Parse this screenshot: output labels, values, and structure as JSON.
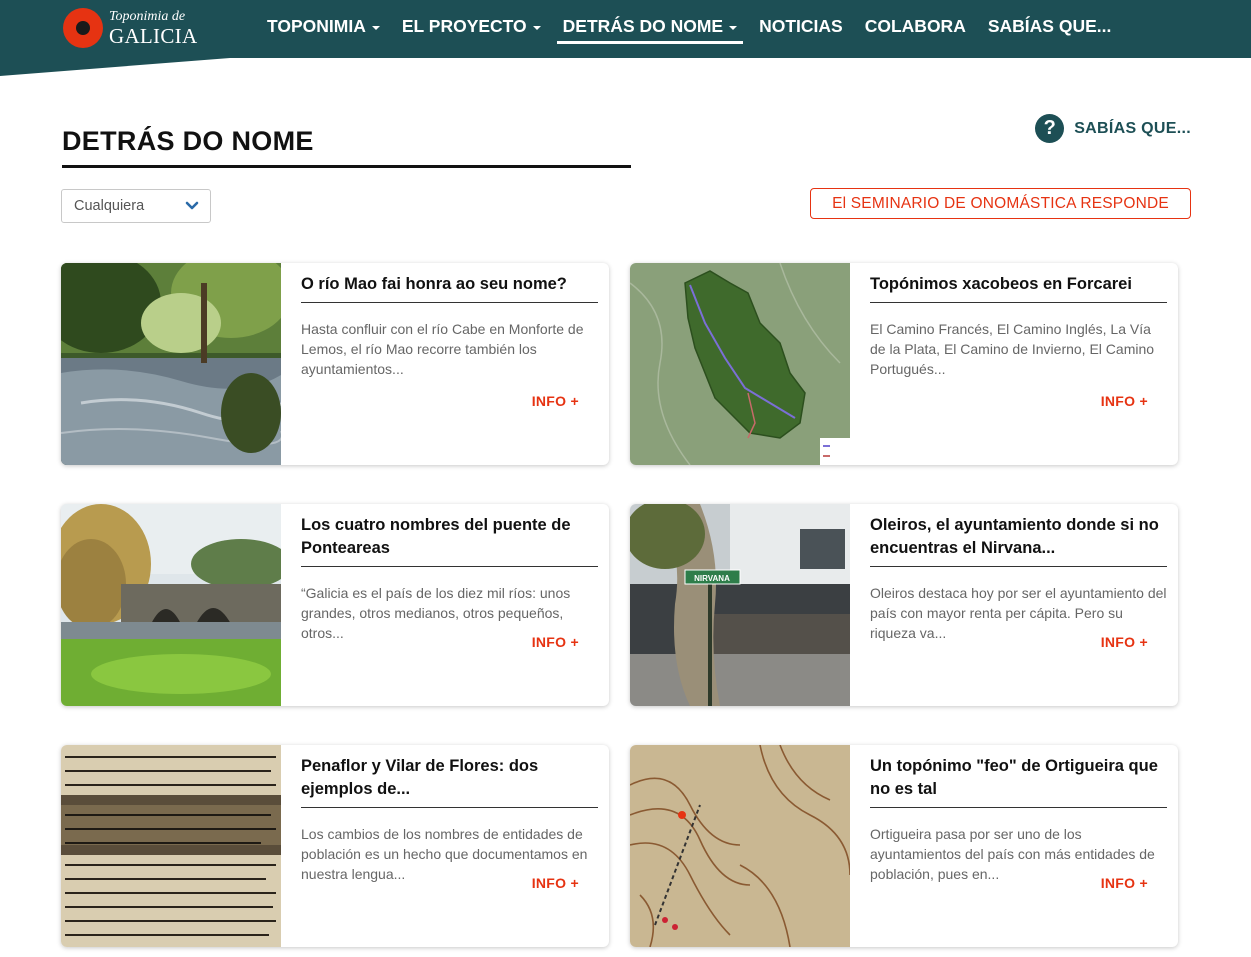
{
  "header": {
    "logo_top": "Toponimia de",
    "logo_bottom": "GALICIA",
    "nav": [
      {
        "label": "TOPONIMIA",
        "dropdown": true,
        "active": false
      },
      {
        "label": "EL PROYECTO",
        "dropdown": true,
        "active": false
      },
      {
        "label": "DETRÁS DO NOME",
        "dropdown": true,
        "active": true
      },
      {
        "label": "NOTICIAS",
        "dropdown": false,
        "active": false
      },
      {
        "label": "COLABORA",
        "dropdown": false,
        "active": false
      },
      {
        "label": "SABÍAS QUE...",
        "dropdown": false,
        "active": false
      }
    ]
  },
  "page": {
    "title": "DETRÁS DO NOME",
    "sabias_label": "SABÍAS QUE...",
    "sabias_icon": "question-icon",
    "filter_value": "Cualquiera",
    "responde_label": "El SEMINARIO DE ONOMÁSTICA RESPONDE"
  },
  "cards": [
    {
      "title": "O río Mao fai honra ao seu nome?",
      "excerpt": "Hasta confluir con el río Cabe en Monforte de Lemos, el río Mao recorre también los ayuntamientos...",
      "info": "INFO +",
      "image": "river-photo"
    },
    {
      "title": "Topónimos xacobeos en Forcarei",
      "excerpt": "El Camino Francés, El Camino Inglés, La Vía de la Plata, El Camino de Invierno, El Camino Portugués...",
      "info": "INFO +",
      "image": "map-photo"
    },
    {
      "title": "Los cuatro nombres del puente de Ponteareas",
      "excerpt": "“Galicia es el país de los diez mil ríos: unos grandes, otros medianos, otros pequeños, otros...",
      "info": "INFO +",
      "image": "bridge-photo"
    },
    {
      "title": "Oleiros, el ayuntamiento donde si no encuentras el Nirvana...",
      "excerpt": "Oleiros destaca hoy por ser el ayuntamiento del país con mayor renta per cápita. Pero su riqueza va...",
      "info": "INFO +",
      "image": "street-sign-photo",
      "sign_text": "NIRVANA"
    },
    {
      "title": "Penaflor y Vilar de Flores: dos ejemplos de...",
      "excerpt": "Los cambios de los nombres de entidades de población es un hecho que documentamos en nuestra lengua...",
      "info": "INFO +",
      "image": "old-dictionary-photo"
    },
    {
      "title": "Un topónimo \"feo\" de Ortigueira que no es tal",
      "excerpt": "Ortigueira pasa por ser uno de los ayuntamientos del país con más entidades de población, pues en...",
      "info": "INFO +",
      "image": "old-map-photo"
    }
  ],
  "colors": {
    "header_bg": "#1d4f55",
    "accent": "#e63312"
  }
}
